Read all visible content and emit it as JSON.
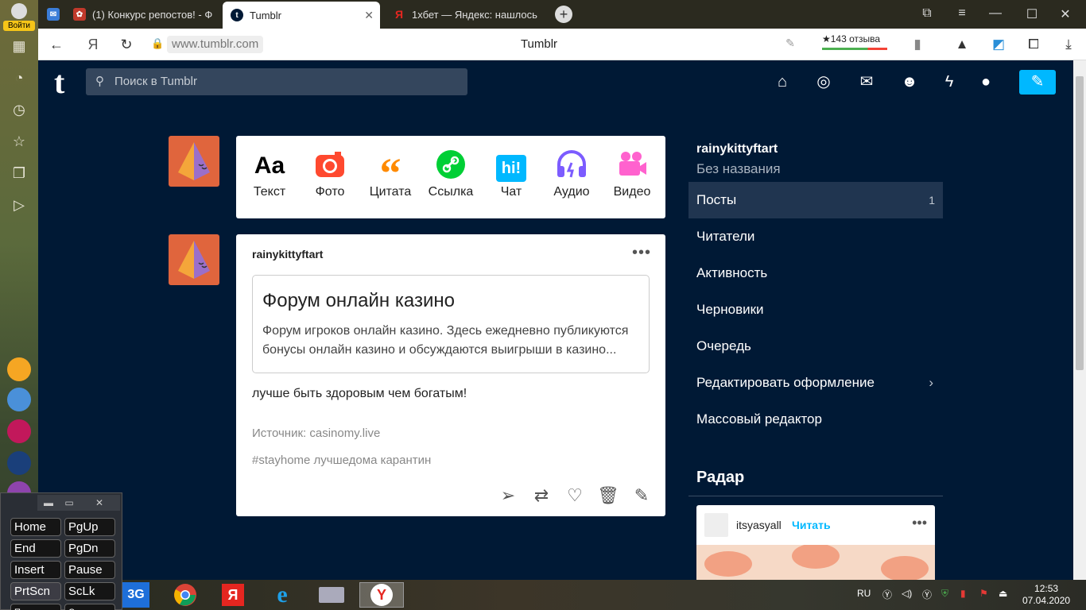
{
  "sidebar": {
    "login_label": "Войти"
  },
  "tabs": [
    {
      "title": "(1) Конкурс репостов! - Ф"
    },
    {
      "title": "Tumblr",
      "fav": "t"
    },
    {
      "title": "1хбет — Яндекс: нашлось"
    }
  ],
  "addressbar": {
    "url": "www.tumblr.com",
    "page_title": "Tumblr",
    "reviews": "★143 отзыва"
  },
  "header": {
    "logo": "t",
    "search_placeholder": "Поиск в Tumblr"
  },
  "post_types": [
    {
      "label": "Текст",
      "icon": "Aa",
      "color": "#000000"
    },
    {
      "label": "Фото",
      "icon": "camera-icon",
      "color": "#ff492f"
    },
    {
      "label": "Цитата",
      "icon": "quote-icon",
      "color": "#ff8a00"
    },
    {
      "label": "Ссылка",
      "icon": "link-icon",
      "color": "#00cf35"
    },
    {
      "label": "Чат",
      "icon": "hi!",
      "color": "#00b8ff"
    },
    {
      "label": "Аудио",
      "icon": "headphones-icon",
      "color": "#7c5cff"
    },
    {
      "label": "Видео",
      "icon": "video-icon",
      "color": "#ff62ce"
    }
  ],
  "post": {
    "author": "rainykittyftart",
    "link_title": "Форум онлайн казино",
    "link_desc": "Форум игроков онлайн казино. Здесь ежедневно публикуются бонусы онлайн казино и обсуждаются выигрыши в казино...",
    "body": "лучше быть здоровым чем богатым!",
    "source": "Источник: casinomy.live",
    "tags": "#stayhome лучшедома карантин"
  },
  "right": {
    "blog_name": "rainykittyftart",
    "blog_subtitle": "Без названия",
    "menu": [
      {
        "label": "Посты",
        "count": "1"
      },
      {
        "label": "Читатели"
      },
      {
        "label": "Активность"
      },
      {
        "label": "Черновики"
      },
      {
        "label": "Очередь"
      },
      {
        "label": "Редактировать оформление"
      },
      {
        "label": "Массовый редактор"
      }
    ],
    "radar_title": "Радар",
    "radar_user": "itsyasyall",
    "radar_follow": "Читать"
  },
  "osk": {
    "keys": [
      "Home",
      "PgUp",
      "End",
      "PgDn",
      "Insert",
      "Pause",
      "PrtScn",
      "ScLk",
      "Параметры",
      "Справка"
    ]
  },
  "taskbar": {
    "lang": "RU",
    "time": "12:53",
    "date": "07.04.2020",
    "label_3g": "3G"
  }
}
